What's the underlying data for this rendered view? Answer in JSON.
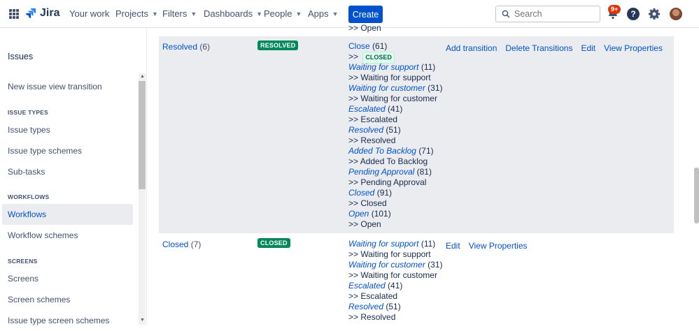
{
  "nav": {
    "logo": "Jira",
    "your_work": "Your work",
    "projects": "Projects",
    "filters": "Filters",
    "dashboards": "Dashboards",
    "people": "People",
    "apps": "Apps",
    "create": "Create",
    "search_placeholder": "Search",
    "notif_count": "9+",
    "help": "?"
  },
  "sidebar": {
    "title": "Issues",
    "items": {
      "new_issue_view": "New issue view transition",
      "issue_types_head": "ISSUE TYPES",
      "issue_types": "Issue types",
      "issue_type_schemes": "Issue type schemes",
      "sub_tasks": "Sub-tasks",
      "workflows_head": "WORKFLOWS",
      "workflows": "Workflows",
      "workflow_schemes": "Workflow schemes",
      "screens_head": "SCREENS",
      "screens": "Screens",
      "screen_schemes": "Screen schemes",
      "issue_type_screen_schemes": "Issue type screen schemes"
    }
  },
  "top_cut": ">> Open",
  "rows": [
    {
      "status": "Resolved",
      "count": "(6)",
      "lozenge": "RESOLVED",
      "transitions": [
        {
          "name": "Close",
          "id": "(61)",
          "target": "CLOSED",
          "target_lozenge": true,
          "italic": false
        },
        {
          "name": "Waiting for support",
          "id": "(11)",
          "target": "Waiting for support"
        },
        {
          "name": "Waiting for customer",
          "id": "(31)",
          "target": "Waiting for customer"
        },
        {
          "name": "Escalated",
          "id": "(41)",
          "target": "Escalated"
        },
        {
          "name": "Resolved",
          "id": "(51)",
          "target": "Resolved"
        },
        {
          "name": "Added To Backlog",
          "id": "(71)",
          "target": "Added To Backlog"
        },
        {
          "name": "Pending Approval",
          "id": "(81)",
          "target": "Pending Approval"
        },
        {
          "name": "Closed",
          "id": "(91)",
          "target": "Closed"
        },
        {
          "name": "Open",
          "id": "(101)",
          "target": "Open"
        }
      ],
      "ops": [
        "Add transition",
        "Delete Transitions",
        "Edit",
        "View Properties"
      ]
    },
    {
      "status": "Closed",
      "count": "(7)",
      "lozenge": "CLOSED",
      "transitions": [
        {
          "name": "Waiting for support",
          "id": "(11)",
          "target": "Waiting for support"
        },
        {
          "name": "Waiting for customer",
          "id": "(31)",
          "target": "Waiting for customer"
        },
        {
          "name": "Escalated",
          "id": "(41)",
          "target": "Escalated"
        },
        {
          "name": "Resolved",
          "id": "(51)",
          "target": "Resolved"
        }
      ],
      "ops": [
        "Edit",
        "View Properties"
      ]
    }
  ]
}
